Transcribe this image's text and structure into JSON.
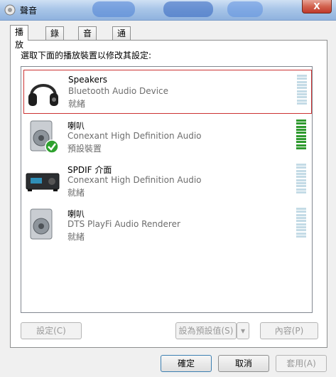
{
  "window": {
    "title": "聲音",
    "close_label": "X"
  },
  "tabs": [
    {
      "label": "播放",
      "active": true
    },
    {
      "label": "錄製",
      "active": false
    },
    {
      "label": "音效",
      "active": false
    },
    {
      "label": "通訊",
      "active": false
    }
  ],
  "instruction": "選取下面的播放裝置以修改其設定:",
  "devices": [
    {
      "name": "Speakers",
      "description": "Bluetooth Audio Device",
      "status": "就緒",
      "icon": "headphones-icon",
      "selected": true,
      "meter_active": false
    },
    {
      "name": "喇叭",
      "description": "Conexant High Definition Audio",
      "status": "預設裝置",
      "icon": "speaker-default-icon",
      "selected": false,
      "meter_active": true
    },
    {
      "name": "SPDIF 介面",
      "description": "Conexant High Definition Audio",
      "status": "就緒",
      "icon": "spdif-receiver-icon",
      "selected": false,
      "meter_active": false
    },
    {
      "name": "喇叭",
      "description": "DTS PlayFi Audio Renderer",
      "status": "就緒",
      "icon": "speaker-icon",
      "selected": false,
      "meter_active": false
    }
  ],
  "buttons": {
    "configure": "設定(C)",
    "set_default": "設為預設值(S)",
    "properties": "內容(P)",
    "ok": "確定",
    "cancel": "取消",
    "apply": "套用(A)"
  },
  "colors": {
    "selection_border": "#cc3333",
    "meter_active": "#2f9a2f",
    "meter_idle": "#c4dbe6"
  }
}
